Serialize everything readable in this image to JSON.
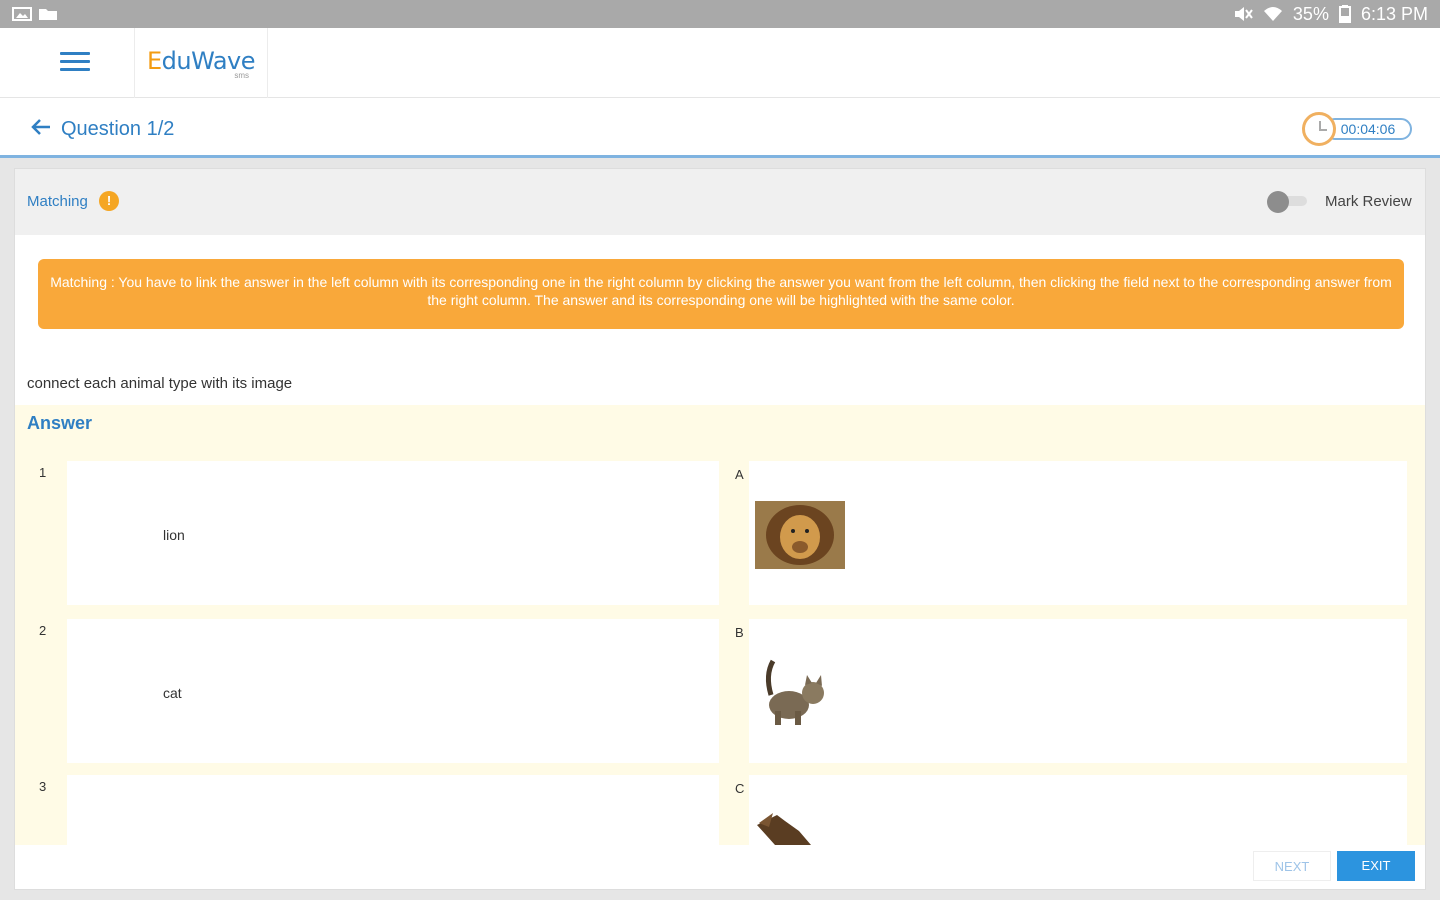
{
  "status_bar": {
    "battery": "35%",
    "time": "6:13 PM"
  },
  "header": {
    "logo_main": "duWave",
    "logo_e": "E",
    "logo_sub": "sms"
  },
  "question_bar": {
    "title": "Question 1/2",
    "timer": "00:04:06"
  },
  "card": {
    "type_label": "Matching",
    "info_glyph": "!",
    "mark_review_label": "Mark Review",
    "instructions": "Matching : You have to link the answer in the left column with its corresponding one in the right column by clicking the answer you want from the left column, then clicking the field next to the corresponding answer from the right column. The answer and its corresponding one will be highlighted with the same color.",
    "question_text": "connect each animal type with its image",
    "answer_title": "Answer",
    "left_items": [
      {
        "num": "1",
        "text": "lion"
      },
      {
        "num": "2",
        "text": "cat"
      },
      {
        "num": "3",
        "text": ""
      }
    ],
    "right_items": [
      {
        "letter": "A",
        "image": "lion-image"
      },
      {
        "letter": "B",
        "image": "cat-image"
      },
      {
        "letter": "C",
        "image": "crocodile-image"
      }
    ],
    "next_label": "NEXT",
    "exit_label": "EXIT"
  },
  "colors": {
    "accent": "#2f7fc3",
    "banner": "#f9a83a",
    "answer_bg": "#fffbe6",
    "exit": "#2c94df"
  }
}
